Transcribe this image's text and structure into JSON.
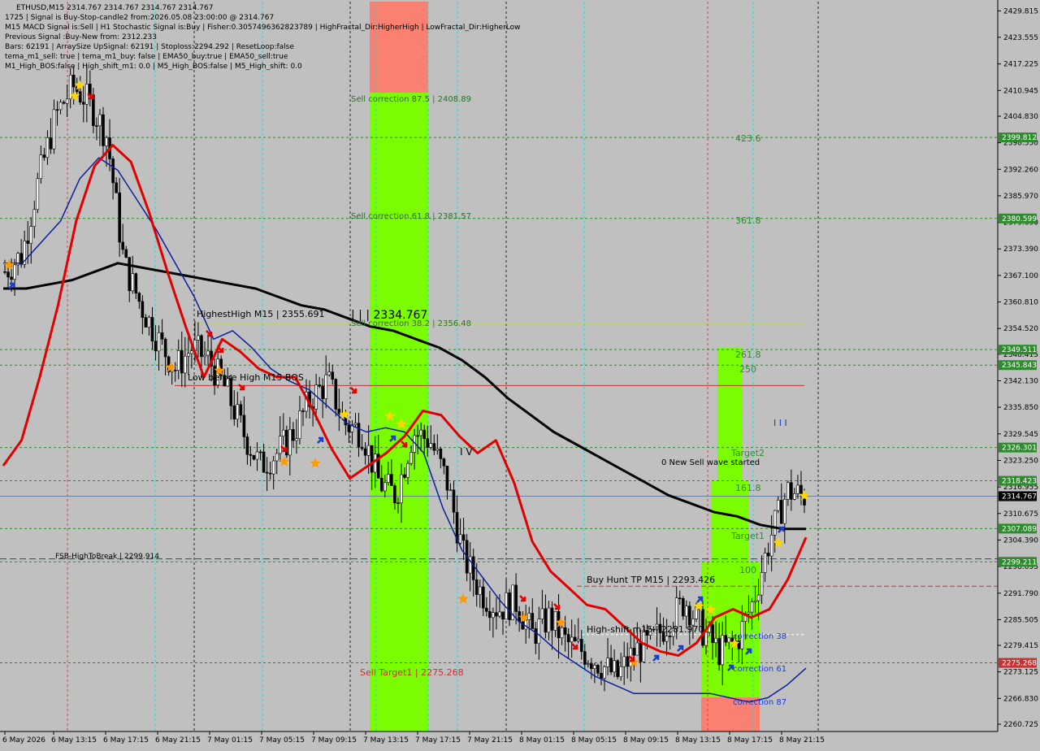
{
  "window": {
    "symbol_line": "ETHUSD,M15  2314.767 2314.767 2314.767 2314.767"
  },
  "info_lines": [
    "1725 | Signal is Buy-Stop-candle2 from:2026.05.08 23:00:00 @ 2314.767",
    "M15 MACD Signal is:Sell | H1 Stochastic Signal is:Buy | Fisher:0.3057496362823789 | HighFractal_Dir:HigherHigh | LowFractal_Dir:HigherLow",
    "Previous Signal :Buy-New from: 2312.233",
    "Bars: 62191 | ArraySize UpSignal: 62191 | Stoploss:2294.292 | ResetLoop:false",
    "tema_m1_sell: true | tema_m1_buy: false | EMA50_buy:true | EMA50_sell:true",
    "M1_High_BOS:false | High_shift_m1: 0.0 | M5_High_BOS:false | M5_High_shift: 0.0"
  ],
  "chart_data": {
    "type": "candlestick",
    "symbol": "ETHUSD",
    "timeframe": "M15",
    "ylim": [
      2259.0,
      2432.0
    ],
    "y_ticks": [
      2429.815,
      2423.555,
      2417.225,
      2410.945,
      2404.83,
      2398.55,
      2392.26,
      2385.97,
      2379.69,
      2373.39,
      2367.1,
      2360.81,
      2354.52,
      2348.415,
      2342.13,
      2335.85,
      2329.545,
      2323.25,
      2316.955,
      2310.675,
      2304.39,
      2298.095,
      2291.79,
      2285.505,
      2279.415,
      2273.125,
      2266.83,
      2260.725
    ],
    "x_ticks": [
      "6 May 2026",
      "6 May 13:15",
      "6 May 17:15",
      "6 May 21:15",
      "7 May 01:15",
      "7 May 05:15",
      "7 May 09:15",
      "7 May 13:15",
      "7 May 17:15",
      "7 May 21:15",
      "8 May 01:15",
      "8 May 05:15",
      "8 May 09:15",
      "8 May 13:15",
      "8 May 17:15",
      "8 May 21:15"
    ],
    "current_price": 2314.767,
    "price_tags": [
      {
        "value": 2399.812,
        "color": "#2e8b2e"
      },
      {
        "value": 2380.599,
        "color": "#2e8b2e"
      },
      {
        "value": 2349.511,
        "color": "#2e8b2e"
      },
      {
        "value": 2345.843,
        "color": "#2e8b2e"
      },
      {
        "value": 2326.301,
        "color": "#2e8b2e"
      },
      {
        "value": 2318.423,
        "color": "#2e8b2e"
      },
      {
        "value": 2314.767,
        "color": "#000000"
      },
      {
        "value": 2307.089,
        "color": "#2e8b2e"
      },
      {
        "value": 2299.211,
        "color": "#2e8b2e"
      },
      {
        "value": 2275.268,
        "color": "#c83232"
      }
    ],
    "hlines": [
      {
        "value": 2399.812,
        "color": "#2e8b2e",
        "dash": "3,3"
      },
      {
        "value": 2380.599,
        "color": "#2e8b2e",
        "dash": "3,3"
      },
      {
        "value": 2349.511,
        "color": "#2e8b2e",
        "dash": "3,3"
      },
      {
        "value": 2345.843,
        "color": "#2e8b2e",
        "dash": "3,3"
      },
      {
        "value": 2326.301,
        "color": "#2e8b2e",
        "dash": "3,3"
      },
      {
        "value": 2318.423,
        "color": "#2e8b2e",
        "dash": "3,3"
      },
      {
        "value": 2314.767,
        "color": "#6b7fa0",
        "dash": ""
      },
      {
        "value": 2307.089,
        "color": "#2e8b2e",
        "dash": "3,3"
      },
      {
        "value": 2299.914,
        "color": "#1a3dcc",
        "dash": "8,4"
      },
      {
        "value": 2299.211,
        "color": "#2e8b2e",
        "dash": "3,3"
      },
      {
        "value": 2275.268,
        "color": "#c83232",
        "dash": "3,3"
      }
    ],
    "annotations": [
      {
        "text": "Sell correction 87.5 | 2408.89",
        "color": "#2f6e2f"
      },
      {
        "text": "Sell correction 61.8 | 2381.57",
        "color": "#2f6e2f"
      },
      {
        "text": "Sell correction 38.2 | 2356.48",
        "color": "#2f6e2f"
      },
      {
        "text": "Sell Target1 | 2275.268",
        "color": "#c83232"
      },
      {
        "text": "HighestHigh   M15 | 2355.691",
        "color": "#000000"
      },
      {
        "text": "| | | 2334.767",
        "color": "#000000"
      },
      {
        "text": "Low before High   M15-BOS",
        "color": "#000000"
      },
      {
        "text": "I V",
        "color": "#000000"
      },
      {
        "text": "FSB-HighToBreak | 2299.914",
        "color": "#000000"
      },
      {
        "text": "Buy Hunt TP M15 | 2293.426",
        "color": "#000000"
      },
      {
        "text": "High-shift m15 | 2281.970",
        "color": "#000000"
      },
      {
        "text": "0 New Sell wave started",
        "color": "#000000"
      },
      {
        "text": "423.6",
        "color": "#2e8b2e"
      },
      {
        "text": "361.8",
        "color": "#2e8b2e"
      },
      {
        "text": "261.8",
        "color": "#2e8b2e"
      },
      {
        "text": "250",
        "color": "#2e8b2e"
      },
      {
        "text": "161.8",
        "color": "#2e8b2e"
      },
      {
        "text": "100",
        "color": "#2e8b2e"
      },
      {
        "text": "Target2",
        "color": "#2e8b2e"
      },
      {
        "text": "Target1",
        "color": "#2e8b2e"
      },
      {
        "text": "correction 38",
        "color": "#1a3dcc"
      },
      {
        "text": "correction 61",
        "color": "#1a3dcc"
      },
      {
        "text": "correction 87",
        "color": "#1a3dcc"
      },
      {
        "text": "I I I",
        "color": "#1a3dcc"
      }
    ],
    "series": [
      {
        "key": "ema_fast",
        "color": "#e00000",
        "values": [
          2322,
          2328,
          2343,
          2360,
          2380,
          2393,
          2398,
          2394,
          2382,
          2368,
          2355,
          2343,
          2352,
          2349,
          2345,
          2343,
          2343,
          2335,
          2326,
          2319,
          2322,
          2325,
          2329,
          2335,
          2334,
          2329,
          2325,
          2328,
          2318,
          2304,
          2297,
          2293,
          2289,
          2288,
          2284,
          2280,
          2278,
          2277,
          2280,
          2286,
          2288,
          2286,
          2288,
          2295,
          2305
        ]
      },
      {
        "key": "ema_mid",
        "color": "#0a1f9e",
        "values": [
          2370,
          2370,
          2375,
          2380,
          2390,
          2395,
          2392,
          2385,
          2378,
          2370,
          2362,
          2352,
          2354,
          2350,
          2345,
          2342,
          2340,
          2336,
          2332,
          2330,
          2331,
          2330,
          2325,
          2312,
          2302,
          2296,
          2290,
          2285,
          2282,
          2278,
          2275,
          2272,
          2270,
          2268,
          2268,
          2268,
          2268,
          2268,
          2267,
          2266,
          2267,
          2270,
          2274
        ]
      },
      {
        "key": "ema_slow",
        "color": "#000000",
        "values": [
          2364,
          2364,
          2365,
          2366,
          2368,
          2370,
          2369,
          2368,
          2367,
          2366,
          2365,
          2364,
          2362,
          2360,
          2359,
          2357,
          2355,
          2354,
          2352,
          2350,
          2347,
          2343,
          2338,
          2334,
          2330,
          2327,
          2324,
          2321,
          2318,
          2315,
          2313,
          2311,
          2310,
          2308,
          2307,
          2307
        ]
      },
      {
        "key": "close",
        "color": "#000000",
        "values": [
          2368,
          2372,
          2390,
          2405,
          2412,
          2408,
          2400,
          2370,
          2360,
          2352,
          2345,
          2350,
          2347,
          2340,
          2330,
          2322,
          2325,
          2330,
          2338,
          2342,
          2332,
          2330,
          2318,
          2315,
          2330,
          2328,
          2318,
          2300,
          2292,
          2288,
          2290,
          2282,
          2286,
          2280,
          2278,
          2275,
          2272,
          2278,
          2280,
          2285,
          2290,
          2283,
          2278,
          2280,
          2290,
          2305,
          2316,
          2314.767
        ]
      }
    ]
  }
}
